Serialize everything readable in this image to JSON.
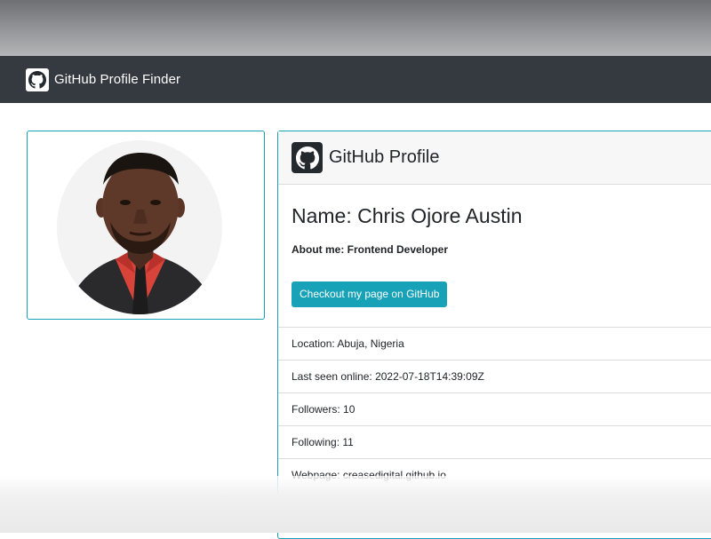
{
  "navbar": {
    "logo_icon": "github-icon",
    "title": "GitHub Profile Finder",
    "background": "#343a40"
  },
  "photo": {
    "icon": "profile-photo",
    "border_color": "#17a2b8"
  },
  "profile": {
    "header_icon": "github-icon",
    "header_title": "GitHub Profile",
    "name": "Name: Chris Ojore Austin",
    "about": "About me: Frontend Developer",
    "button_label": "Checkout my page on GitHub",
    "button_color": "#17a2b8",
    "details": [
      "Location: Abuja, Nigeria",
      "Last seen online: 2022-07-18T14:39:09Z",
      "Followers: 10",
      "Following: 11",
      "Webpage: creasedigital.github.io"
    ]
  }
}
